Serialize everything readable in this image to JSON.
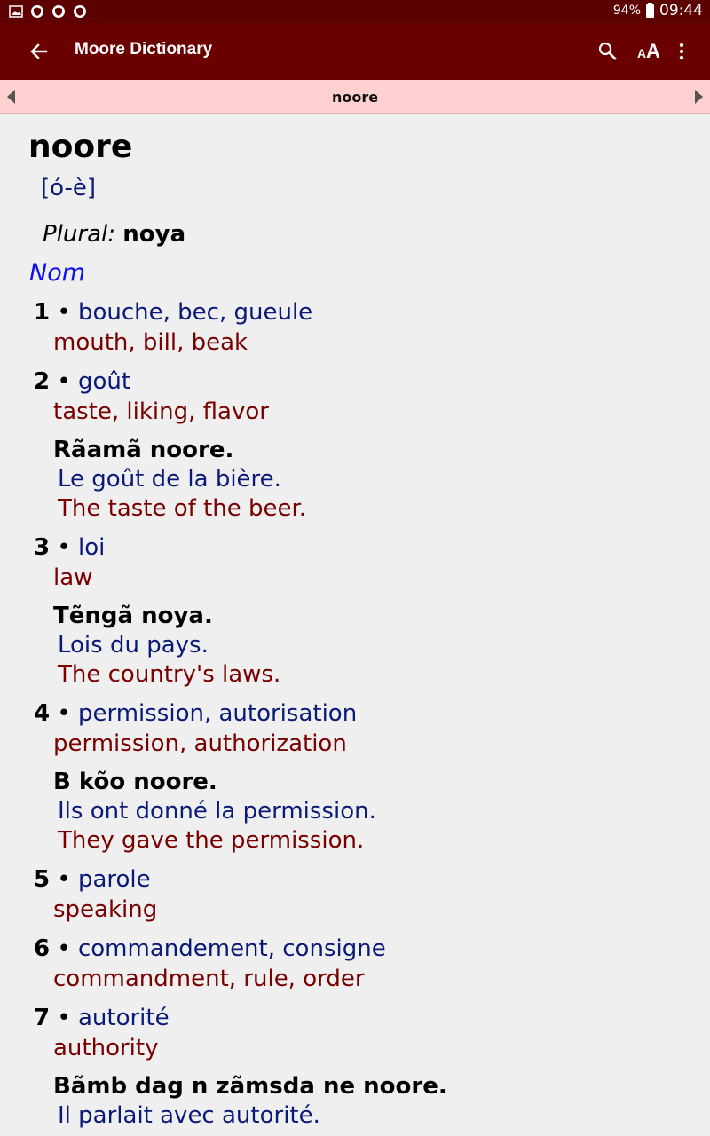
{
  "status_bar": {
    "icons": [
      "gallery-icon",
      "shield-icon",
      "shield-icon",
      "shield-icon"
    ],
    "battery": "94%",
    "time": "09:44"
  },
  "app_bar": {
    "title": "Moore Dictionary",
    "actions": [
      "search-icon",
      "font-size-icon",
      "more-options-icon"
    ]
  },
  "nav": {
    "current_word": "noore"
  },
  "entry": {
    "headword": "noore",
    "pronunciation": "[ó-è]",
    "plural_label": "Plural:",
    "plural": "noya",
    "part_of_speech": "Nom",
    "senses": [
      {
        "num": "1",
        "fr": "bouche, bec, gueule",
        "en": "mouth, bill, beak"
      },
      {
        "num": "2",
        "fr": "goût",
        "en": "taste, liking, flavor",
        "example": {
          "moore": "Rãamã noore.",
          "fr": "Le goût de la bière.",
          "en": "The taste of the beer."
        }
      },
      {
        "num": "3",
        "fr": "loi",
        "en": "law",
        "example": {
          "moore": "Tẽngã noya.",
          "fr": "Lois du pays.",
          "en": "The country's laws."
        }
      },
      {
        "num": "4",
        "fr": "permission, autorisation",
        "en": "permission, authorization",
        "example": {
          "moore": "B kõo noore.",
          "fr": "Ils ont donné la permission.",
          "en": "They gave the permission."
        }
      },
      {
        "num": "5",
        "fr": "parole",
        "en": "speaking"
      },
      {
        "num": "6",
        "fr": "commandement, consigne",
        "en": "commandment, rule, order"
      },
      {
        "num": "7",
        "fr": "autorité",
        "en": "authority",
        "example": {
          "moore": "Bãmb dag n zãmsda ne noore.",
          "fr": "Il parlait avec autorité."
        }
      }
    ]
  },
  "colors": {
    "status_bar": "#5c0000",
    "app_bar": "#6b0000",
    "nav_bar": "#ffd0d0",
    "background": "#efefef",
    "french_text": "#0a1a78",
    "english_text": "#7a0000",
    "part_of_speech": "#1010ee"
  }
}
